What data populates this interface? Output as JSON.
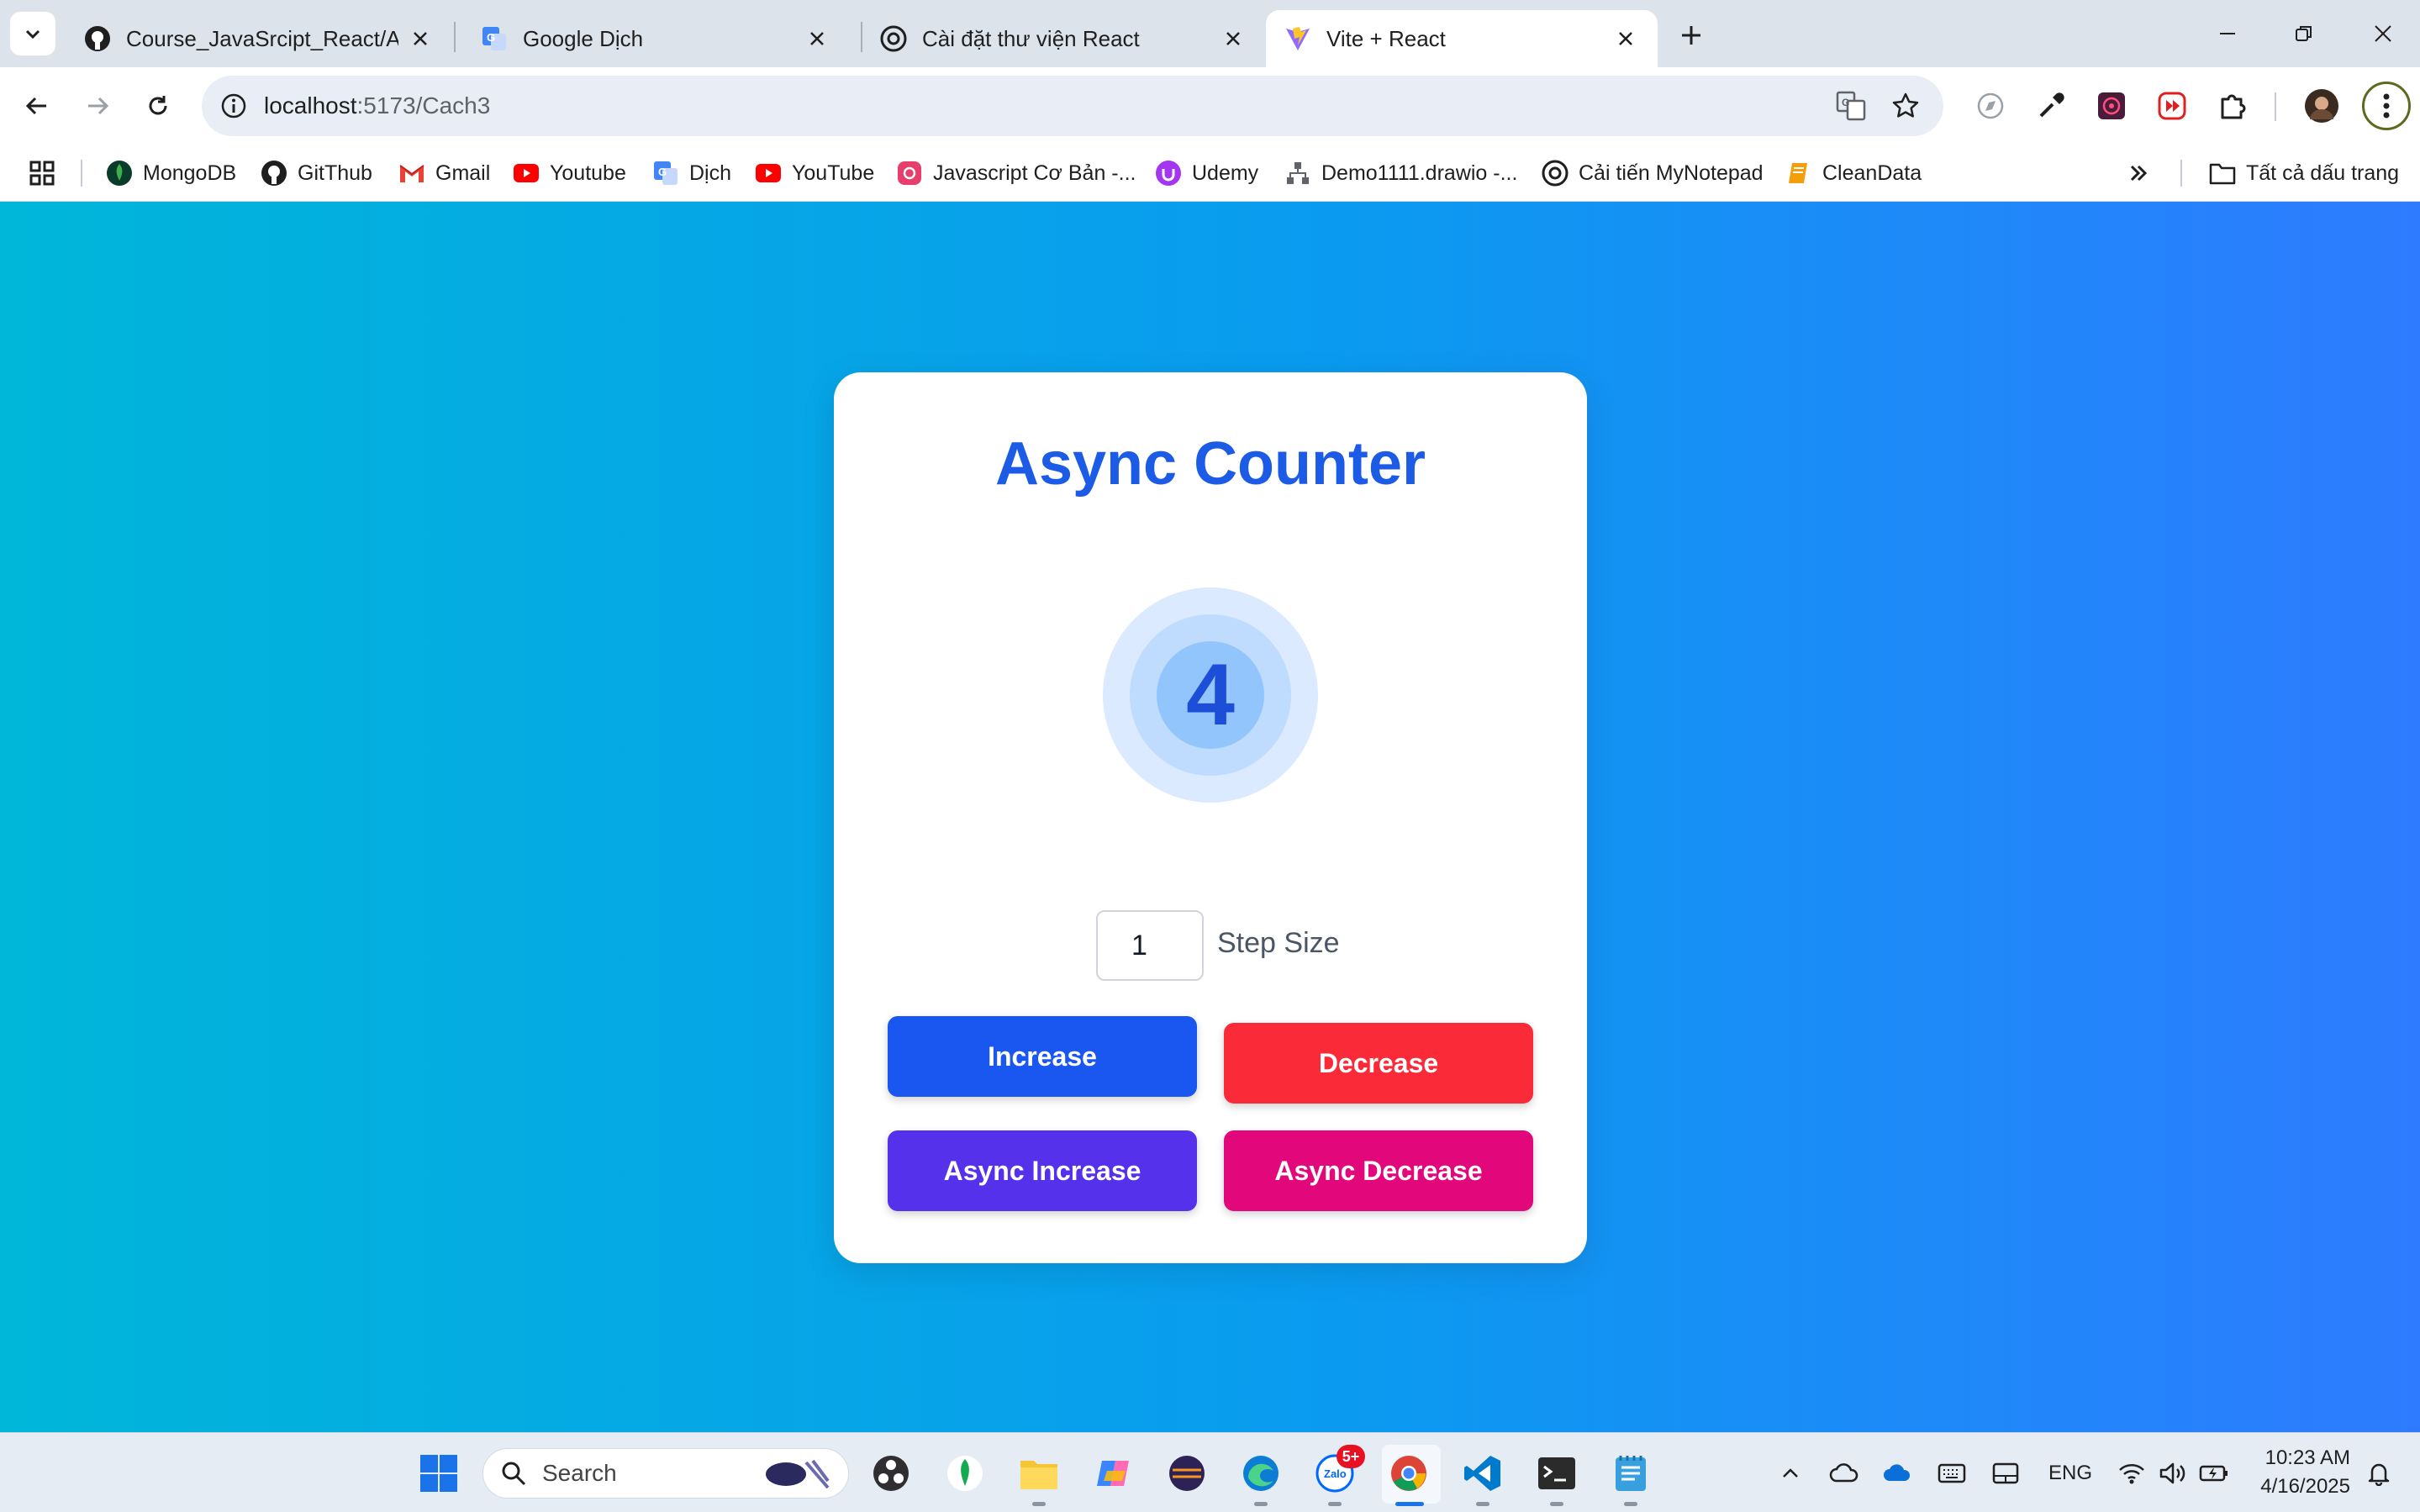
{
  "browser": {
    "tabs": [
      {
        "title": "Course_JavaSrcipt_React/Admin",
        "active": false
      },
      {
        "title": "Google Dịch",
        "active": false
      },
      {
        "title": "Cài đặt thư viện React",
        "active": false
      },
      {
        "title": "Vite + React",
        "active": true
      }
    ],
    "url_host": "localhost",
    "url_rest": ":5173/Cach3",
    "bookmarks": [
      "MongoDB",
      "GitThub",
      "Gmail",
      "Youtube",
      "Dịch",
      "YouTube",
      "Javascript Cơ Bản -...",
      "Udemy",
      "Demo1111.drawio -...",
      "Cải tiến MyNotepad",
      "CleanData"
    ],
    "all_bookmarks": "Tất cả dấu trang",
    "icons": {
      "tab_menu": "chevron-down-icon",
      "back": "back-arrow-icon",
      "forward": "forward-arrow-icon",
      "reload": "reload-icon",
      "site_info": "info-icon",
      "translate": "translate-icon",
      "bookmark_star": "star-icon",
      "extensions": "puzzle-icon",
      "menu": "kebab-menu-icon"
    }
  },
  "app": {
    "title": "Async Counter",
    "count": "4",
    "step_value": "1",
    "step_label": "Step Size",
    "buttons": {
      "increase": "Increase",
      "decrease": "Decrease",
      "async_increase": "Async Increase",
      "async_decrease": "Async Decrease"
    },
    "colors": {
      "title": "#1c5be6",
      "increase": "#1a56f0",
      "decrease": "#fb2a38",
      "async_increase": "#5531eb",
      "async_decrease": "#e2077a",
      "bg_start": "#00b6d9",
      "bg_end": "#2e7bff"
    }
  },
  "taskbar": {
    "search_placeholder": "Search",
    "zalo_badge": "5+",
    "language": "ENG",
    "time": "10:23 AM",
    "date": "4/16/2025"
  }
}
